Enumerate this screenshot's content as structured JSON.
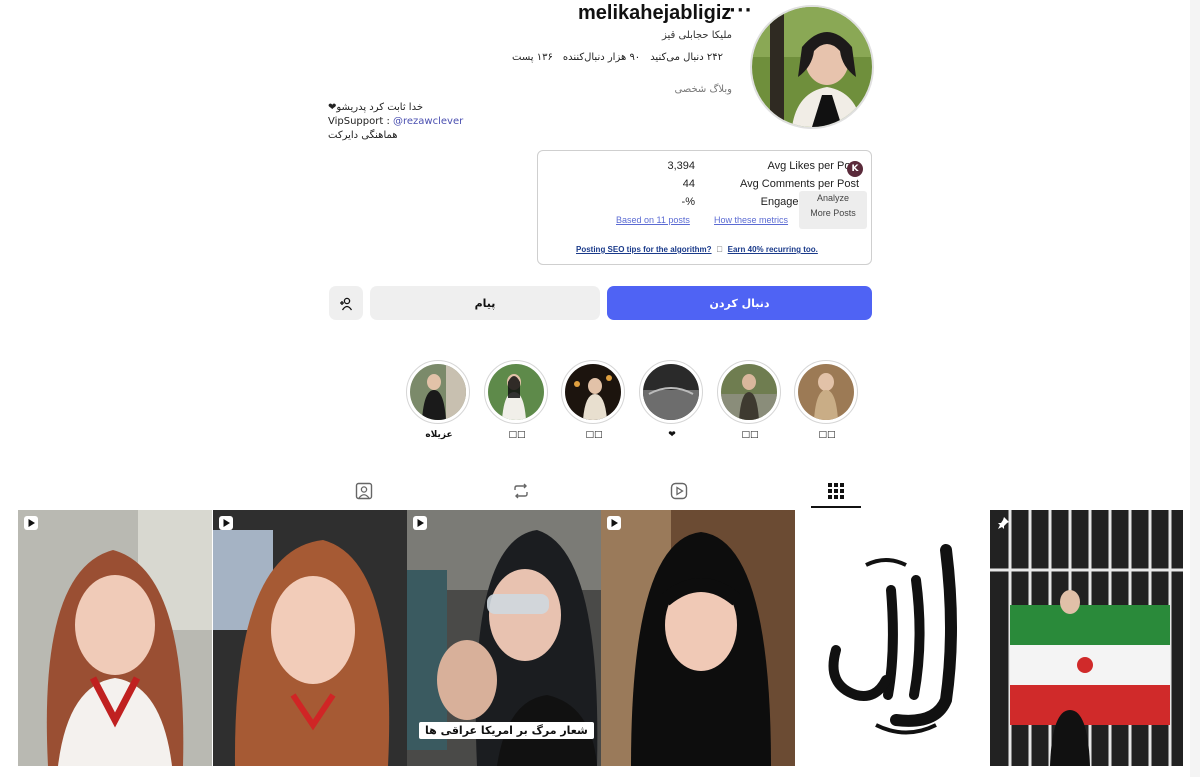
{
  "profile": {
    "username": "melikahejabligiz",
    "more": "···",
    "full_name": "ملیکا حجابلی قیز",
    "stats": [
      "۱۳۶ پست",
      "۹۰ هزار دنبال‌کننده",
      "۲۴۲ دنبال می‌کنید"
    ],
    "category": "وبلاگ شخصی",
    "bio_line1": "خدا ثابت کرد پدریشو❤",
    "bio_line2_prefix": "VipSupport : ",
    "bio_line2_mention": "@rezawclever",
    "bio_line3": "هماهنگی دایرکت"
  },
  "metrics": {
    "avg_likes_label": "Avg Likes per Post",
    "avg_likes_value": "3,394",
    "avg_comments_label": "Avg Comments per Post",
    "avg_comments_value": "44",
    "engagement_label": "Engagement",
    "engagement_value": "-%",
    "based_on": "Based on 11 posts",
    "how_metrics": "How these metrics",
    "analyze": "Analyze",
    "more_posts": "More Posts",
    "k_badge": "K",
    "tip_a": "Posting SEO tips for the algorithm?",
    "tip_sep": "🗆",
    "tip_b": "Earn 40% recurring too."
  },
  "buttons": {
    "follow": "دنبال کردن",
    "message": "پیام",
    "suggest_icon": "add-person-icon"
  },
  "highlights": [
    {
      "label": "□□"
    },
    {
      "label": "□□"
    },
    {
      "label": "❤"
    },
    {
      "label": "□□"
    },
    {
      "label": "□□"
    },
    {
      "label": "عزیلاه"
    }
  ],
  "tabs": [
    {
      "name": "posts",
      "icon": "grid-icon",
      "active": true
    },
    {
      "name": "reels",
      "icon": "reels-icon",
      "active": false
    },
    {
      "name": "reposts",
      "icon": "repost-icon",
      "active": false
    },
    {
      "name": "tagged",
      "icon": "tagged-icon",
      "active": false
    }
  ],
  "posts": [
    {
      "type": "reel"
    },
    {
      "type": "reel"
    },
    {
      "type": "reel",
      "caption": "شعار مرگ بر امریکا عراقی ها"
    },
    {
      "type": "reel"
    },
    {
      "type": "image",
      "art_text": "کلمة الله هي العليا"
    },
    {
      "type": "pinned"
    }
  ],
  "colors": {
    "accent": "#4f63f4",
    "button_gray": "#efefef",
    "link": "#5b6bd3"
  }
}
